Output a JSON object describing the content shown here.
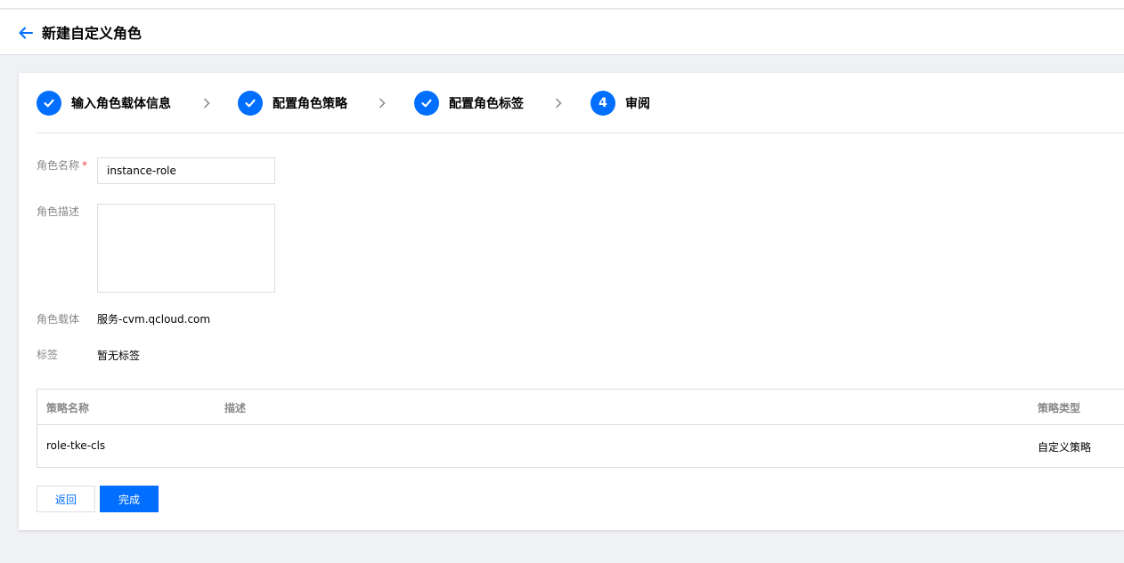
{
  "header": {
    "title": "新建自定义角色",
    "back_icon": "arrow-left-icon"
  },
  "steps": [
    {
      "label": "输入角色载体信息",
      "status": "done",
      "icon": "check-icon"
    },
    {
      "label": "配置角色策略",
      "status": "done",
      "icon": "check-icon"
    },
    {
      "label": "配置角色标签",
      "status": "done",
      "icon": "check-icon"
    },
    {
      "label": "审阅",
      "status": "current",
      "number": "4"
    }
  ],
  "form": {
    "role_name_label": "角色名称",
    "required_mark": "*",
    "role_name_value": "instance-role",
    "role_desc_label": "角色描述",
    "role_desc_value": "",
    "role_carrier_label": "角色载体",
    "role_carrier_value": "服务-cvm.qcloud.com",
    "tags_label": "标签",
    "tags_value": "暂无标签"
  },
  "policy_table": {
    "columns": [
      "策略名称",
      "描述",
      "策略类型"
    ],
    "rows": [
      [
        "role-tke-cls",
        "",
        "自定义策略"
      ]
    ]
  },
  "actions": {
    "back_label": "返回",
    "done_label": "完成"
  },
  "colors": {
    "accent": "#006eff",
    "background": "#f0f1f5",
    "required": "#e54545"
  }
}
